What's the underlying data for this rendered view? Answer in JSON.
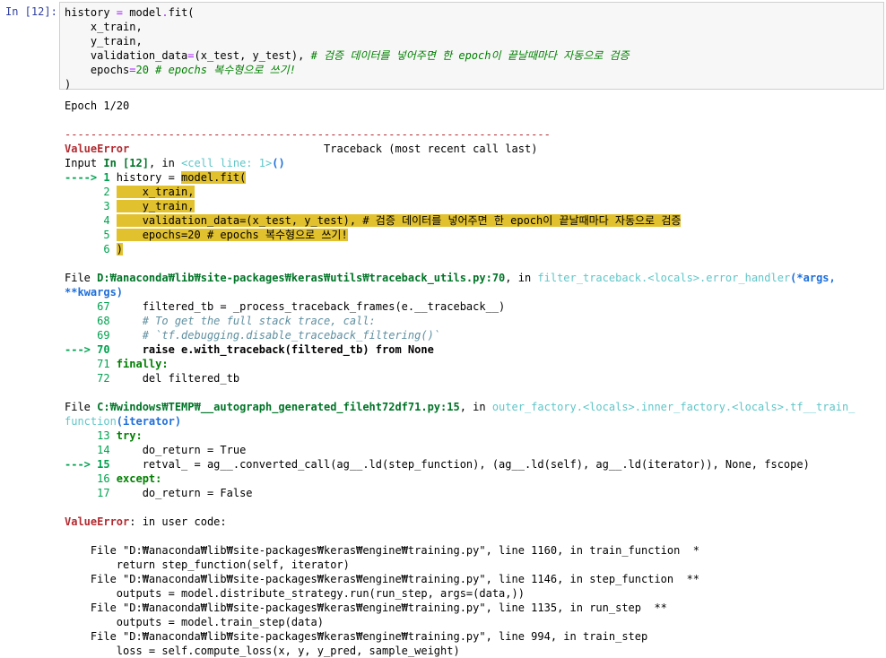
{
  "cell": {
    "prompt": "In [12]:",
    "code_lines": [
      "history = model.fit(",
      "    x_train,",
      "    y_train,",
      "    validation_data=(x_test, y_test), # 검증 데이터를 넣어주면 한 epoch이 끝날때마다 자동으로 검증",
      "    epochs=20 # epochs 복수형으로 쓰기!",
      ")"
    ]
  },
  "output": {
    "epoch_line": "Epoch 1/20",
    "separator": "---------------------------------------------------------------------------",
    "error_header": {
      "name": "ValueError",
      "spacer": "                              ",
      "traceback": "Traceback (most recent call last)"
    },
    "input_line": {
      "prefix": "Input ",
      "in": "In [12]",
      "comma": ", in ",
      "cell": "<cell line: 1>",
      "paren": "()"
    },
    "frame1": [
      {
        "marker": "----> 1 ",
        "code": "history = ",
        "hl": "model.fit("
      },
      {
        "marker": "      2 ",
        "code": "",
        "hl": "    x_train,"
      },
      {
        "marker": "      3 ",
        "code": "",
        "hl": "    y_train,"
      },
      {
        "marker": "      4 ",
        "code": "",
        "hl": "    validation_data=(x_test, y_test), # 검증 데이터를 넣어주면 한 epoch이 끝날때마다 자동으로 검증"
      },
      {
        "marker": "      5 ",
        "code": "",
        "hl": "    epochs=20 # epochs 복수형으로 쓰기!"
      },
      {
        "marker": "      6 ",
        "code": "",
        "hl": ")"
      }
    ],
    "file1": {
      "prefix": "File ",
      "path": "D:₩anaconda₩lib₩site-packages₩keras₩utils₩traceback_utils.py:70",
      "mid": ", in ",
      "func": "filter_traceback.<locals>.error_handler",
      "args1": "(*args,",
      "args2": "**kwargs)"
    },
    "file1_lines": [
      {
        "marker": "     67 ",
        "code": "    filtered_tb = _process_traceback_frames(e.__traceback__)"
      },
      {
        "marker": "     68 ",
        "code": "    # To get the full stack trace, call:"
      },
      {
        "marker": "     69 ",
        "code": "    # `tf.debugging.disable_traceback_filtering()`"
      },
      {
        "marker": "---> 70 ",
        "code": "    raise e.with_traceback(filtered_tb) from None"
      },
      {
        "marker": "     71 ",
        "code": "finally:"
      },
      {
        "marker": "     72 ",
        "code": "    del filtered_tb"
      }
    ],
    "file2": {
      "prefix": "File ",
      "path": "C:₩windows₩TEMP₩__autograph_generated_fileht72df71.py:15",
      "mid": ", in ",
      "func": "outer_factory.<locals>.inner_factory.<locals>.tf__train_",
      "func2": "function",
      "args": "(iterator)"
    },
    "file2_lines": [
      {
        "marker": "     13 ",
        "code": "try:"
      },
      {
        "marker": "     14 ",
        "code": "    do_return = True"
      },
      {
        "marker": "---> 15 ",
        "code": "    retval_ = ag__.converted_call(ag__.ld(step_function), (ag__.ld(self), ag__.ld(iterator)), None, fscope)"
      },
      {
        "marker": "     16 ",
        "code": "except:"
      },
      {
        "marker": "     17 ",
        "code": "    do_return = False"
      }
    ],
    "final_error": {
      "name": "ValueError",
      "rest": ": in user code:"
    },
    "user_trace": [
      "    File \"D:₩anaconda₩lib₩site-packages₩keras₩engine₩training.py\", line 1160, in train_function  *",
      "        return step_function(self, iterator)",
      "    File \"D:₩anaconda₩lib₩site-packages₩keras₩engine₩training.py\", line 1146, in step_function  **",
      "        outputs = model.distribute_strategy.run(run_step, args=(data,))",
      "    File \"D:₩anaconda₩lib₩site-packages₩keras₩engine₩training.py\", line 1135, in run_step  **",
      "        outputs = model.train_step(data)",
      "    File \"D:₩anaconda₩lib₩site-packages₩keras₩engine₩training.py\", line 994, in train_step",
      "        loss = self.compute_loss(x, y, y_pred, sample_weight)"
    ]
  }
}
